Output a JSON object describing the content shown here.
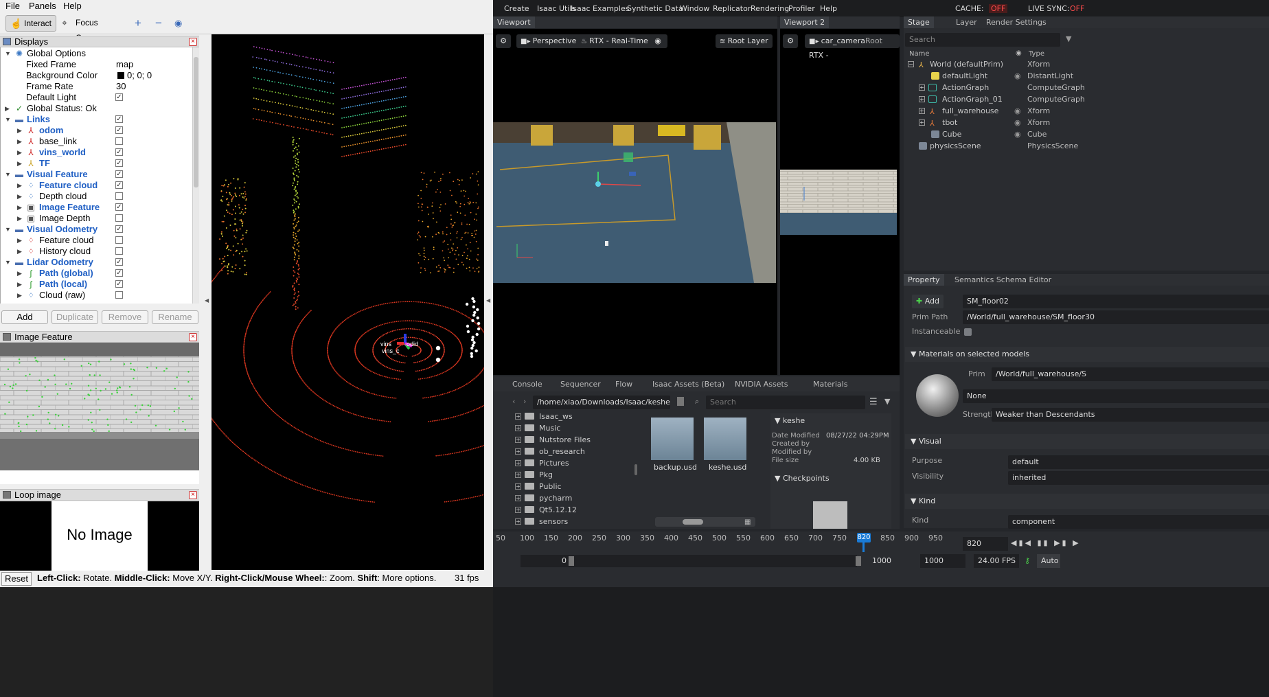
{
  "rviz": {
    "menu": {
      "file": "File",
      "panels": "Panels",
      "help": "Help"
    },
    "toolbar": {
      "interact": "Interact",
      "focus_camera": "Focus Camera",
      "plus": "+",
      "minus": "−"
    },
    "displays": {
      "title": "Displays",
      "global_options": "Global Options",
      "fixed_frame_label": "Fixed Frame",
      "fixed_frame_value": "map",
      "bg_color_label": "Background Color",
      "bg_color_value": "0; 0; 0",
      "frame_rate_label": "Frame Rate",
      "frame_rate_value": "30",
      "default_light_label": "Default Light",
      "global_status": "Global Status: Ok",
      "links": "Links",
      "odom": "odom",
      "base_link": "base_link",
      "vins_world": "vins_world",
      "tf": "TF",
      "visual_feature": "Visual Feature",
      "feature_cloud": "Feature cloud",
      "depth_cloud": "Depth cloud",
      "image_feature": "Image Feature",
      "image_depth": "Image Depth",
      "visual_odometry": "Visual Odometry",
      "vo_feature_cloud": "Feature cloud",
      "history_cloud": "History cloud",
      "lidar_odometry": "Lidar Odometry",
      "path_global": "Path (global)",
      "path_local": "Path (local)",
      "cloud_raw": "Cloud (raw)"
    },
    "buttons": {
      "add": "Add",
      "duplicate": "Duplicate",
      "remove": "Remove",
      "rename": "Rename"
    },
    "image_feature_title": "Image Feature",
    "loop_image_title": "Loop image",
    "no_image": "No Image",
    "status": {
      "reset": "Reset",
      "lc": "Left-Click:",
      "lc_t": " Rotate. ",
      "mc": "Middle-Click:",
      "mc_t": " Move X/Y. ",
      "rc": "Right-Click/Mouse Wheel:",
      "rc_t": ": Zoom. ",
      "sh": "Shift",
      "sh_t": ": More options.",
      "fps": "31 fps"
    },
    "view_labels": {
      "a": "vins",
      "b": "vins_c",
      "c": "odid"
    }
  },
  "isaac": {
    "menu": [
      "Create",
      "Isaac Utils",
      "Isaac Examples",
      "Synthetic Data",
      "Window",
      "Replicator",
      "Rendering",
      "Profiler",
      "Help"
    ],
    "cache_label": "CACHE:",
    "cache_value": "OFF",
    "live_sync_label": "LIVE SYNC:",
    "live_sync_value": "OFF",
    "viewport_tab": "Viewport",
    "viewport2_tab": "Viewport 2",
    "vp1": {
      "camera": "Perspective",
      "render": "RTX - Real-Time",
      "layer": "Root Layer"
    },
    "vp2": {
      "camera": "car_camera",
      "layer": "Root",
      "render": "RTX -"
    },
    "stage_tabs": [
      "Stage",
      "Layer",
      "Render Settings"
    ],
    "search_placeholder": "Search",
    "col_name": "Name",
    "col_type": "Type",
    "prims": [
      {
        "name": "World (defaultPrim)",
        "type": "Xform"
      },
      {
        "name": "defaultLight",
        "type": "DistantLight"
      },
      {
        "name": "ActionGraph",
        "type": "ComputeGraph"
      },
      {
        "name": "ActionGraph_01",
        "type": "ComputeGraph"
      },
      {
        "name": "full_warehouse",
        "type": "Xform"
      },
      {
        "name": "tbot",
        "type": "Xform"
      },
      {
        "name": "Cube",
        "type": "Cube"
      },
      {
        "name": "physicsScene",
        "type": "PhysicsScene"
      }
    ],
    "prop_tabs": [
      "Property",
      "Semantics Schema Editor"
    ],
    "add_label": "Add",
    "prim_name": "SM_floor02",
    "prim_path_label": "Prim Path",
    "prim_path": "/World/full_warehouse/SM_floor30",
    "instanceable_label": "Instanceable",
    "materials_head": "Materials on selected models",
    "prim_label": "Prim",
    "material_prim": "/World/full_warehouse/S",
    "material_value": "None",
    "strength_label": "Strength",
    "strength_value": "Weaker than Descendants",
    "visual_head": "Visual",
    "purpose_label": "Purpose",
    "purpose_value": "default",
    "visibility_label": "Visibility",
    "visibility_value": "inherited",
    "kind_head": "Kind",
    "kind_label": "Kind",
    "kind_value": "component",
    "content_tabs": [
      "Console",
      "Sequencer",
      "Flow",
      "Isaac Assets (Beta)",
      "NVIDIA Assets",
      "Materials"
    ],
    "content_path": "/home/xiao/Downloads/Isaac/keshe/",
    "content_search": "Search",
    "folders": [
      "Isaac_ws",
      "Music",
      "Nutstore Files",
      "ob_research",
      "Pictures",
      "Pkg",
      "Public",
      "pycharm",
      "Qt5.12.12",
      "sensors"
    ],
    "files": [
      {
        "name": "backup.usd"
      },
      {
        "name": "keshe.usd"
      }
    ],
    "details": {
      "title": "keshe",
      "date_label": "Date Modified",
      "date_value": "08/27/22 04:29PM",
      "created_label": "Created by",
      "modified_label": "Modified by",
      "size_label": "File size",
      "size_value": "4.00 KB",
      "checkpoints": "Checkpoints"
    },
    "timeline": {
      "ticks": [
        "50",
        "100",
        "150",
        "200",
        "250",
        "300",
        "350",
        "400",
        "450",
        "500",
        "550",
        "600",
        "650",
        "700",
        "750",
        "820",
        "850",
        "900",
        "950"
      ],
      "current": "820",
      "start": "0",
      "end": "1000",
      "end2": "1000",
      "fps": "24.00 FPS",
      "auto": "Auto"
    }
  }
}
